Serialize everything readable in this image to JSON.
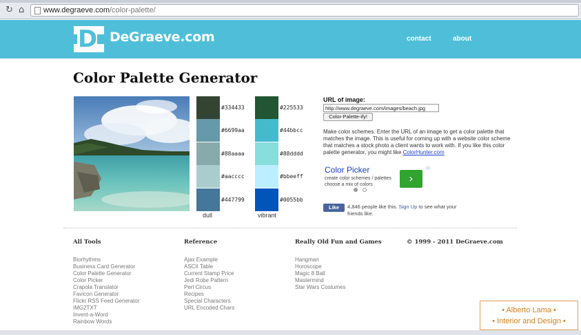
{
  "browser": {
    "back_icon": "reload-icon",
    "home_icon": "home-icon",
    "url_domain": "www.degraeve.com",
    "url_path": "/color-palette/"
  },
  "header": {
    "logo_letter": "D",
    "logo_text": "DeGraeve.com",
    "nav": [
      "contact",
      "about"
    ],
    "color": "#4fbfd9"
  },
  "page": {
    "title": "Color Palette Generator"
  },
  "palettes": {
    "dull": {
      "label": "dull",
      "colors": [
        "#334433",
        "#6699aa",
        "#88aaaa",
        "#aacccc",
        "#447799"
      ]
    },
    "vibrant": {
      "label": "vibrant",
      "colors": [
        "#225533",
        "#44bbcc",
        "#88dddd",
        "#bbeeff",
        "#0055bb"
      ]
    }
  },
  "form": {
    "label": "URL of image:",
    "value": "http://www.degraeve.com/images/beach.jpg",
    "button": "Color-Palette-ify!"
  },
  "description": {
    "text": "Make color schemes. Enter the URL of an image to get a color palette that matches the image. This is useful for coming up with a website color scheme that matches a stock photo a client wants to work with. If you like this color palette generator, you might like ",
    "link": "ColorHunter.com"
  },
  "ad": {
    "title": "Color Picker",
    "line1": "create color schemes / palettes",
    "line2": "choose a mix of colors",
    "go_icon": "chevron-right-icon",
    "badge_icon": "adchoices-icon"
  },
  "facebook": {
    "button": "Like",
    "text_before": "4,846 people like this. ",
    "signup": "Sign Up",
    "text_after": " to see what your friends like."
  },
  "footer": {
    "columns": [
      {
        "heading": "All Tools",
        "items": [
          "Biorhythms",
          "Business Card Generator",
          "Color Palette Generator",
          "Color Picker",
          "Crapola Translator",
          "Favicon Generator",
          "Flickr RSS Feed Generator",
          "IMG2TXT",
          "Invent-a-Word",
          "Rainbow Words"
        ]
      },
      {
        "heading": "Reference",
        "items": [
          "Ajax Example",
          "ASCII Table",
          "Current Stamp Price",
          "Jedi Robe Pattern",
          "Perl Circus",
          "Recipes",
          "Special Characters",
          "URL Encoded Chars"
        ]
      },
      {
        "heading": "Really Old Fun and Games",
        "items": [
          "Hangman",
          "Horoscope",
          "Magic 8 Ball",
          "Mastermind",
          "Star Wars Costumes"
        ]
      }
    ],
    "copyright": "© 1999 - 2011 DeGraeve.com"
  },
  "watermark": {
    "line1": "• Alberto Lama •",
    "line2": "• Interior and Design •"
  }
}
